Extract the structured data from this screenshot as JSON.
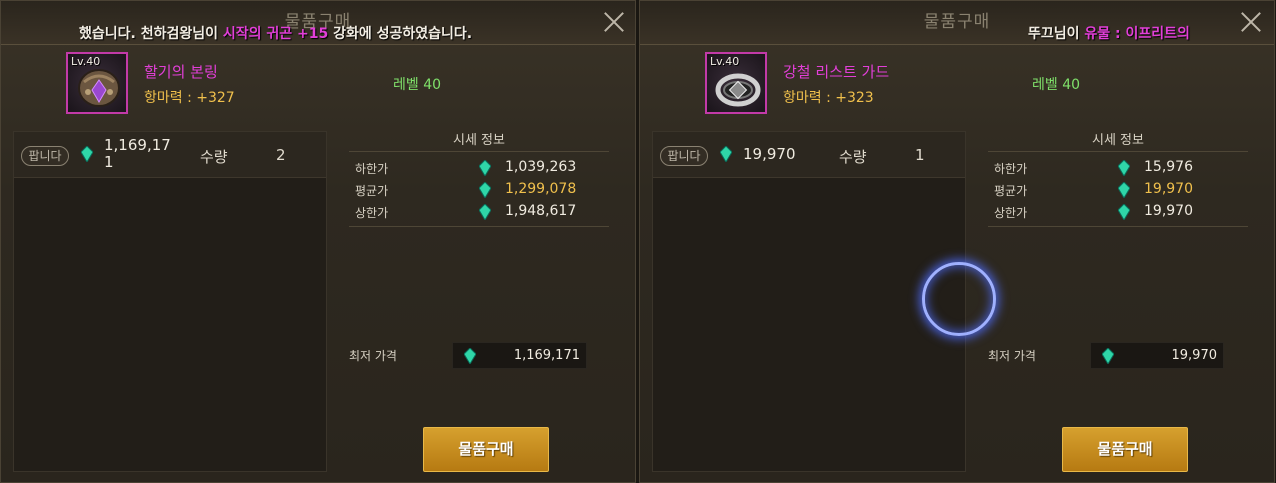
{
  "panels": [
    {
      "title": "물품구매",
      "notice": {
        "pre": "했습니다.     천하검왕님이 ",
        "highlight": "시작의 귀곤 +15",
        "post": " 강화에 성공하였습니다."
      },
      "item": {
        "level_badge": "Lv.40",
        "name": "할기의 본링",
        "stat": "항마력 : +327",
        "level": "레벨 40",
        "icon": "gauntlet-icon"
      },
      "listing": {
        "badge": "팝니다",
        "price": "1,169,171",
        "qty_label": "수량",
        "qty": "2"
      },
      "market": {
        "title": "시세 정보",
        "rows": [
          {
            "label": "하한가",
            "value": "1,039,263"
          },
          {
            "label": "평균가",
            "value": "1,299,078"
          },
          {
            "label": "상한가",
            "value": "1,948,617"
          }
        ]
      },
      "min_label": "최저 가격",
      "min_price": "1,169,171",
      "buy_label": "물품구매"
    },
    {
      "title": "물품구매",
      "notice": {
        "pre": "뚜끄님이 ",
        "highlight": "유물 : 이프리트의",
        "post": ""
      },
      "item": {
        "level_badge": "Lv.40",
        "name": "강철 리스트 가드",
        "stat": "항마력 : +323",
        "level": "레벨 40",
        "icon": "wrist-guard-icon"
      },
      "listing": {
        "badge": "팝니다",
        "price": "19,970",
        "qty_label": "수량",
        "qty": "1"
      },
      "market": {
        "title": "시세 정보",
        "rows": [
          {
            "label": "하한가",
            "value": "15,976"
          },
          {
            "label": "평균가",
            "value": "19,970"
          },
          {
            "label": "상한가",
            "value": "19,970"
          }
        ]
      },
      "min_label": "최저 가격",
      "min_price": "19,970",
      "buy_label": "물품구매"
    }
  ],
  "colors": {
    "item_name": "#e23fd8",
    "stat": "#f0c04c",
    "level": "#7fe06a",
    "button": "#c98c20",
    "loading_ring": "#6a82ff"
  }
}
